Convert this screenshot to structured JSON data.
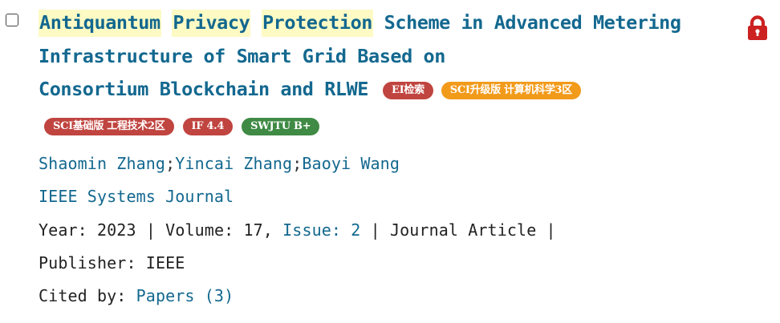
{
  "result": {
    "title": {
      "highlighted": [
        "Antiquantum",
        "Privacy",
        "Protection"
      ],
      "rest": [
        "Scheme",
        "in",
        "Advanced",
        "Metering",
        "Infrastructure",
        "of",
        "Smart",
        "Grid",
        "Based",
        "on",
        "Consortium",
        "Blockchain",
        "and",
        "RLWE"
      ]
    },
    "badges_inline": [
      {
        "label": "EI检索",
        "color": "#c0443f"
      },
      {
        "label": "SCI升级版 计算机科学3区",
        "color": "#f29a1a"
      }
    ],
    "badges_row": [
      {
        "label": "SCI基础版 工程技术2区",
        "color": "#c0443f"
      },
      {
        "label": "IF 4.4",
        "color": "#c0443f"
      },
      {
        "label": "SWJTU B+",
        "color": "#3f8a44"
      }
    ],
    "authors": [
      "Shaomin Zhang",
      "Yincai Zhang",
      "Baoyi Wang"
    ],
    "author_separator": ";",
    "journal": "IEEE Systems Journal",
    "meta": {
      "year_label": "Year:",
      "year": "2023",
      "volume_label": "Volume:",
      "volume": "17,",
      "issue_label": "Issue: 2",
      "type": "Journal Article",
      "separator": "|"
    },
    "publisher_label": "Publisher:",
    "publisher": "IEEE",
    "cited_label": "Cited by:",
    "cited_link": "Papers (3)"
  },
  "icons": {
    "checkbox": "checkbox-icon",
    "lock": "lock-icon",
    "lock_color": "#cc2222"
  }
}
